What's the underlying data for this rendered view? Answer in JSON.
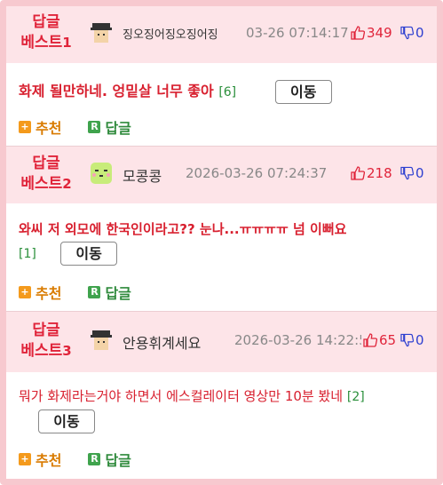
{
  "posts": [
    {
      "rank_label": "답글",
      "rank_sub": "베스트",
      "rank_num": "1",
      "nickname": "징오징어징오징어징",
      "date": "03-26 07:14:17",
      "upvotes": "349",
      "downvotes": "0",
      "body": "화제 될만하네. 엉밑살 너무 좋아",
      "reply_count": "[6]",
      "move_label": "이동",
      "recommend_label": "추천",
      "reply_label": "답글"
    },
    {
      "rank_label": "답글",
      "rank_sub": "베스트",
      "rank_num": "2",
      "nickname": "모콩콩",
      "date": "2026-03-26 07:24:37",
      "upvotes": "218",
      "downvotes": "0",
      "body": "와씨 저 외모에 한국인이라고?? 눈나...ㅠㅠㅠㅠ 넘 이뻐요",
      "reply_count": "[1]",
      "move_label": "이동",
      "recommend_label": "추천",
      "reply_label": "답글"
    },
    {
      "rank_label": "답글",
      "rank_sub": "베스트",
      "rank_num": "3",
      "nickname": "안용휘계세요",
      "date": "2026-03-26 14:22:58",
      "upvotes": "65",
      "downvotes": "0",
      "body": "뭐가 화제라는거야 하면서 에스컬레이터 영상만 10분 봤네",
      "reply_count": "[2]",
      "move_label": "이동",
      "recommend_label": "추천",
      "reply_label": "답글"
    }
  ],
  "icons": {
    "recommend": "plus-icon",
    "reply": "reply-r-icon",
    "upvote": "thumbs-up-icon",
    "downvote": "thumbs-down-icon"
  },
  "colors": {
    "accent_red": "#e0243a",
    "down_blue": "#2d3fd0",
    "header_bg": "#fde4e8",
    "recommend_orange": "#f49a1c",
    "reply_green": "#3fa34d"
  }
}
